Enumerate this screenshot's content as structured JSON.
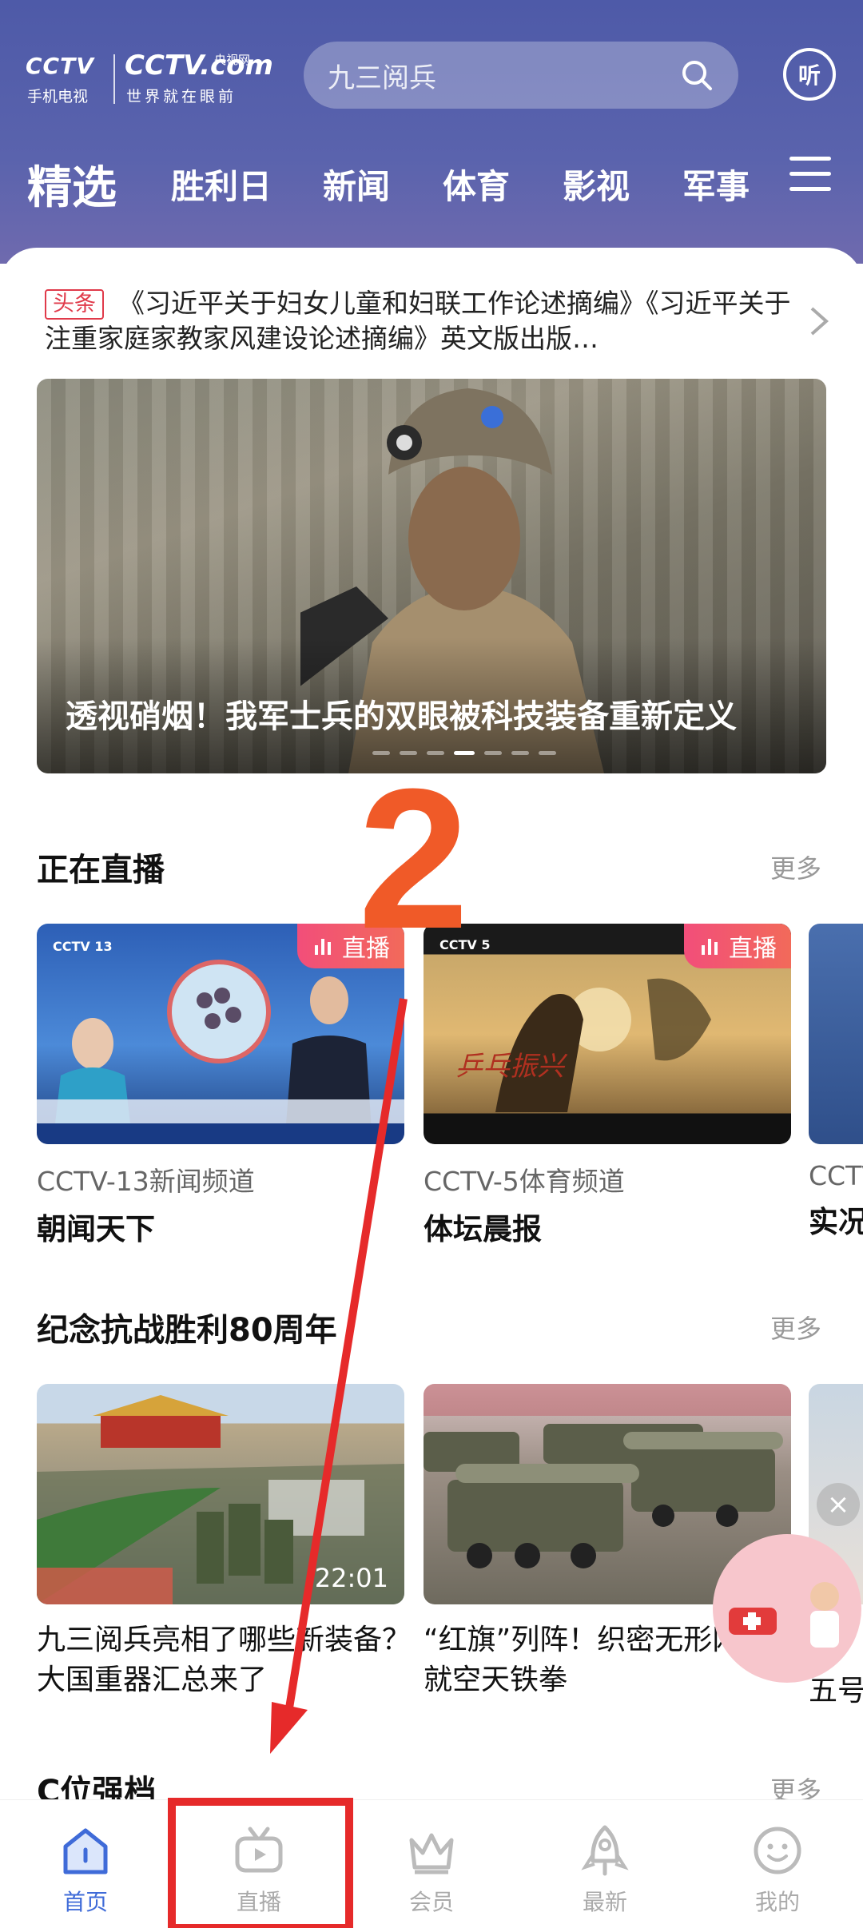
{
  "header": {
    "logo": {
      "line1": "CCTV",
      "line1_sub": "手机电视",
      "line2": "CCTV.com",
      "line2_badge": "央视网",
      "line2_sub": "世界就在眼前"
    },
    "search": {
      "placeholder": "九三阅兵",
      "icon": "search-icon"
    },
    "listen_label": "听",
    "tabs": [
      "精选",
      "胜利日",
      "新闻",
      "体育",
      "影视",
      "军事"
    ],
    "active_tab": "精选"
  },
  "headline": {
    "badge": "头条",
    "text": "《习近平关于妇女儿童和妇联工作论述摘编》《习近平关于注重家庭家教家风建设论述摘编》英文版出版…"
  },
  "banner": {
    "caption": "透视硝烟！我军士兵的双眼被科技装备重新定义",
    "page_count": 7,
    "active_index": 3
  },
  "live": {
    "title": "正在直播",
    "more": "更多",
    "tag": "直播",
    "items": [
      {
        "channel": "CCTV-13新闻频道",
        "program": "朝闻天下",
        "logo": "CCTV 13"
      },
      {
        "channel": "CCTV-5体育频道",
        "program": "体坛晨报",
        "logo": "CCTV 5"
      },
      {
        "channel": "CCTV",
        "program": "实况"
      }
    ]
  },
  "memorial": {
    "title": "纪念抗战胜利80周年",
    "more": "更多",
    "items": [
      {
        "title": "九三阅兵亮相了哪些新装备？大国重器汇总来了",
        "duration": "22:01"
      },
      {
        "title": "“红旗”列阵！织密无形网 铸就空天铁拳",
        "duration": "0"
      },
      {
        "title": "五号"
      }
    ]
  },
  "next_section": {
    "title": "C位强档",
    "more": "更多"
  },
  "annotation": {
    "number": "2",
    "color": "#e62a2a"
  },
  "bottom_nav": [
    {
      "label": "首页",
      "icon": "home-icon",
      "active": true
    },
    {
      "label": "直播",
      "icon": "tv-icon",
      "active": false
    },
    {
      "label": "会员",
      "icon": "crown-icon",
      "active": false
    },
    {
      "label": "最新",
      "icon": "rocket-icon",
      "active": false
    },
    {
      "label": "我的",
      "icon": "smiley-icon",
      "active": false
    }
  ],
  "colors": {
    "header": "#5a63ad",
    "accent_blue": "#3f6bd8",
    "live_tag": "#f24e7a",
    "badge_red": "#e03a4a"
  }
}
